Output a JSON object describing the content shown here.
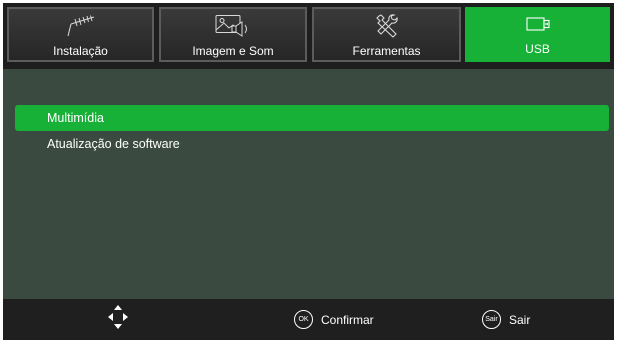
{
  "tabs": [
    {
      "label": "Instalação",
      "icon": "antenna-icon",
      "active": false
    },
    {
      "label": "Imagem e Som",
      "icon": "picture-sound-icon",
      "active": false
    },
    {
      "label": "Ferramentas",
      "icon": "tools-icon",
      "active": false
    },
    {
      "label": "USB",
      "icon": "usb-icon",
      "active": true
    }
  ],
  "menu": {
    "items": [
      {
        "label": "Multimídia",
        "selected": true
      },
      {
        "label": "Atualização de software",
        "selected": false
      }
    ]
  },
  "footer": {
    "nav_icon": "dpad-arrows-icon",
    "ok_badge": "OK",
    "ok_label": "Confirmar",
    "exit_badge": "Sair",
    "exit_label": "Sair"
  },
  "colors": {
    "accent": "#18b138",
    "background": "#3a4a40",
    "bars": "#1f1f1f"
  }
}
